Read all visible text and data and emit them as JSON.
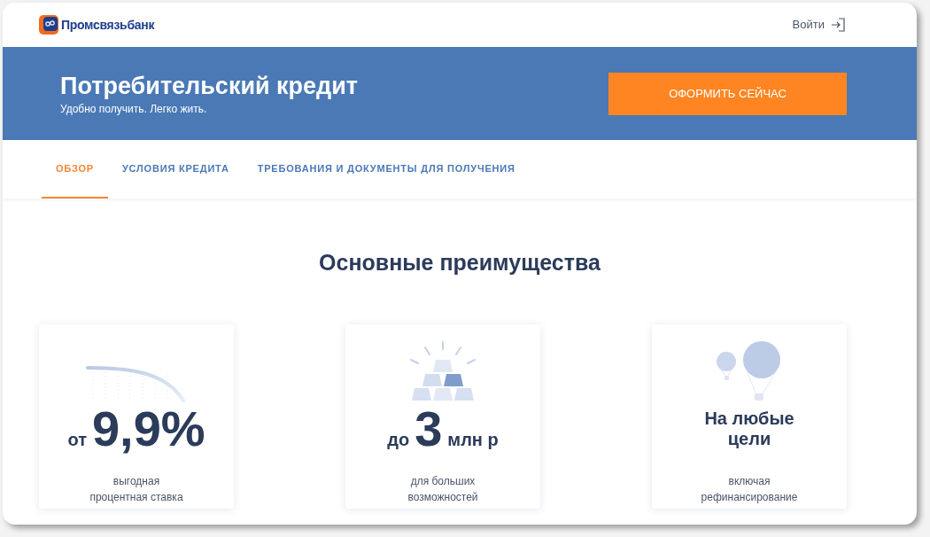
{
  "header": {
    "logo_text": "Промсвязьбанк",
    "login": "Войти"
  },
  "banner": {
    "title": "Потребительский кредит",
    "subtitle": "Удобно получить. Легко жить.",
    "button": "ОФОРМИТЬ СЕЙЧАС"
  },
  "tabs": [
    {
      "label": "ОБЗОР",
      "selected": true
    },
    {
      "label": "УСЛОВИЯ КРЕДИТА",
      "selected": false
    },
    {
      "label": "ТРЕБОВАНИЯ И ДОКУМЕНТЫ ДЛЯ ПОЛУЧЕНИЯ",
      "selected": false
    }
  ],
  "section_title": "Основные преимущества",
  "cards": [
    {
      "kind": "value",
      "prefix": "от",
      "value": "9,9%",
      "description": "выгодная\nпроцентная ставка"
    },
    {
      "kind": "value",
      "prefix": "до",
      "value": "3",
      "suffix": "млн р",
      "description": "для больших\nвозможностей"
    },
    {
      "kind": "title",
      "title": "На любые\nцели",
      "description": "включая\nрефинансирование"
    }
  ]
}
